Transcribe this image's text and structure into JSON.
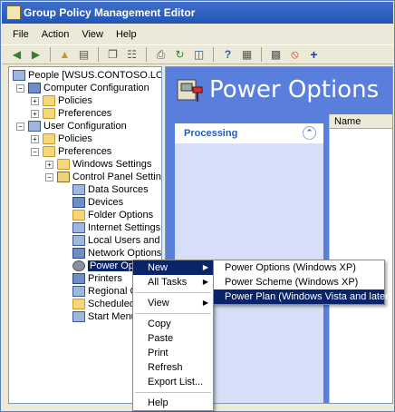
{
  "window": {
    "title": "Group Policy Management Editor"
  },
  "menu": [
    "File",
    "Action",
    "View",
    "Help"
  ],
  "toolbar_icons": [
    "back-icon",
    "forward-icon",
    "up-folder-icon",
    "show-tree-icon",
    "copy-icon",
    "paste-icon",
    "print-icon",
    "refresh-icon",
    "export-icon",
    "help-icon",
    "properties-icon",
    "new-task-icon",
    "delete-icon",
    "add-icon"
  ],
  "tree": {
    "root": "People [WSUS.CONTOSO.LOCAL] P",
    "computer_config": "Computer Configuration",
    "cc_policies": "Policies",
    "cc_preferences": "Preferences",
    "user_config": "User Configuration",
    "uc_policies": "Policies",
    "uc_preferences": "Preferences",
    "windows_settings": "Windows Settings",
    "control_panel": "Control Panel Settings",
    "items": [
      "Data Sources",
      "Devices",
      "Folder Options",
      "Internet Settings",
      "Local Users and Gro",
      "Network Options",
      "Power Options",
      "Printers",
      "Regional Op",
      "Scheduled T",
      "Start Menu"
    ]
  },
  "header": {
    "title": "Power Options"
  },
  "task_panel": {
    "title": "Processing"
  },
  "list": {
    "column": "Name"
  },
  "context_menu": {
    "items": [
      "New",
      "All Tasks",
      "View",
      "Copy",
      "Paste",
      "Print",
      "Refresh",
      "Export List...",
      "Help"
    ]
  },
  "submenu": {
    "items": [
      "Power Options (Windows XP)",
      "Power Scheme (Windows XP)",
      "Power Plan (Windows Vista and later)"
    ]
  },
  "colors": {
    "selection": "#0a246a",
    "header_bg": "#5a7edc",
    "title_bar": "#2355b8"
  }
}
